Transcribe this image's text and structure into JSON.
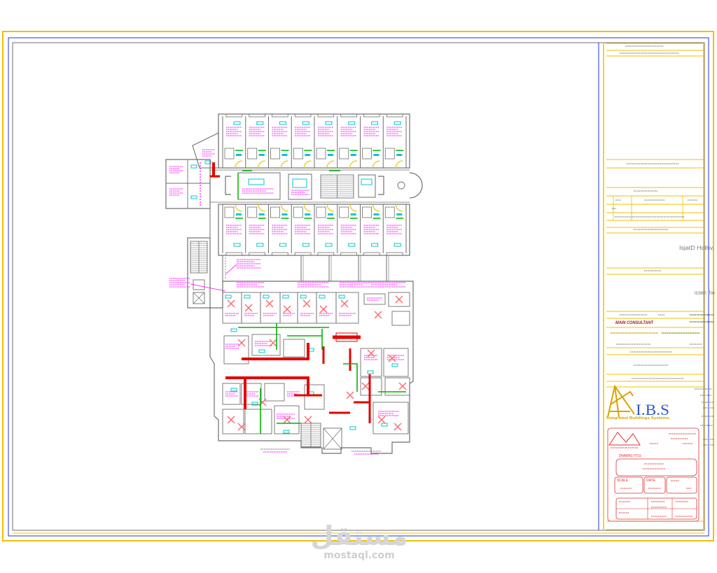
{
  "title_block": {
    "project_line": "IsjatD Hothv,",
    "description_line": "icsen the",
    "main_consultant_label": "MAIN CONSULTANT",
    "logo_text": "I.B.S",
    "company_name": "Integrated Buildings Systems",
    "drawing_title_label": "DRAWING TITLE",
    "scale_label": "SCALE",
    "date_label": "DATE"
  },
  "watermark": {
    "logo_text": "مستقل",
    "site": "mostaql.com"
  },
  "colors": {
    "border": "#f0c000",
    "frame": "#2233ee",
    "wall": "#6e6e6e",
    "label": "#ff00ff",
    "duct": "#e60000",
    "pipe": "#00b400",
    "diffuser": "#00c8d0",
    "door": "#e6c800",
    "xmark": "#ff6a6a",
    "text_mark": "#8a8a8a",
    "logo_blue": "#2f55d4",
    "logo_gold": "#d9a400",
    "stamp_red": "#e03030",
    "watermark": "#d6d6d6"
  }
}
